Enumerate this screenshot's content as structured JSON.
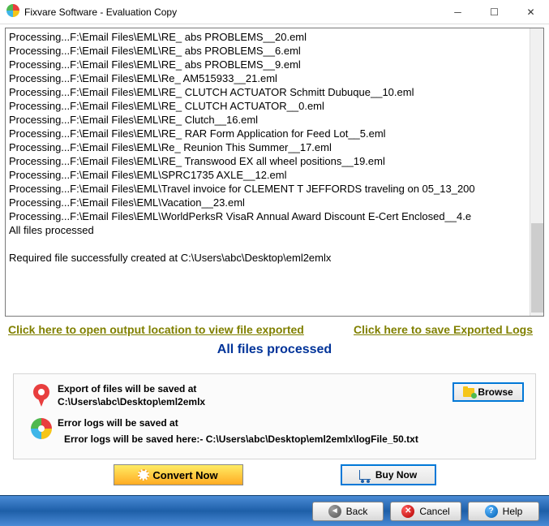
{
  "window": {
    "title": "Fixvare Software - Evaluation Copy"
  },
  "log_lines": [
    "Processing...F:\\Email Files\\EML\\RE_ abs PROBLEMS__20.eml",
    "Processing...F:\\Email Files\\EML\\RE_ abs PROBLEMS__6.eml",
    "Processing...F:\\Email Files\\EML\\RE_ abs PROBLEMS__9.eml",
    "Processing...F:\\Email Files\\EML\\Re_ AM515933__21.eml",
    "Processing...F:\\Email Files\\EML\\RE_ CLUTCH ACTUATOR Schmitt Dubuque__10.eml",
    "Processing...F:\\Email Files\\EML\\RE_ CLUTCH ACTUATOR__0.eml",
    "Processing...F:\\Email Files\\EML\\RE_ Clutch__16.eml",
    "Processing...F:\\Email Files\\EML\\RE_ RAR Form Application for Feed Lot__5.eml",
    "Processing...F:\\Email Files\\EML\\Re_ Reunion This Summer__17.eml",
    "Processing...F:\\Email Files\\EML\\RE_ Transwood EX all wheel positions__19.eml",
    "Processing...F:\\Email Files\\EML\\SPRC1735 AXLE__12.eml",
    "Processing...F:\\Email Files\\EML\\Travel invoice for CLEMENT T JEFFORDS traveling on 05_13_200",
    "Processing...F:\\Email Files\\EML\\Vacation__23.eml",
    "Processing...F:\\Email Files\\EML\\WorldPerksR VisaR Annual Award Discount E-Cert Enclosed__4.e",
    "All files processed",
    "",
    "Required file successfully created at C:\\Users\\abc\\Desktop\\eml2emlx"
  ],
  "links": {
    "open_output": "Click here to open output location to view file exported",
    "save_logs": "Click here to save Exported Logs"
  },
  "status": "All files processed",
  "export": {
    "label": "Export of files will be saved at",
    "path": "C:\\Users\\abc\\Desktop\\eml2emlx",
    "browse_btn": "Browse"
  },
  "errorlog": {
    "label": "Error logs will be saved at",
    "path": "Error logs will be saved here:- C:\\Users\\abc\\Desktop\\eml2emlx\\logFile_50.txt"
  },
  "buttons": {
    "convert": "Convert Now",
    "buy": "Buy Now",
    "back": "Back",
    "cancel": "Cancel",
    "help": "Help"
  }
}
